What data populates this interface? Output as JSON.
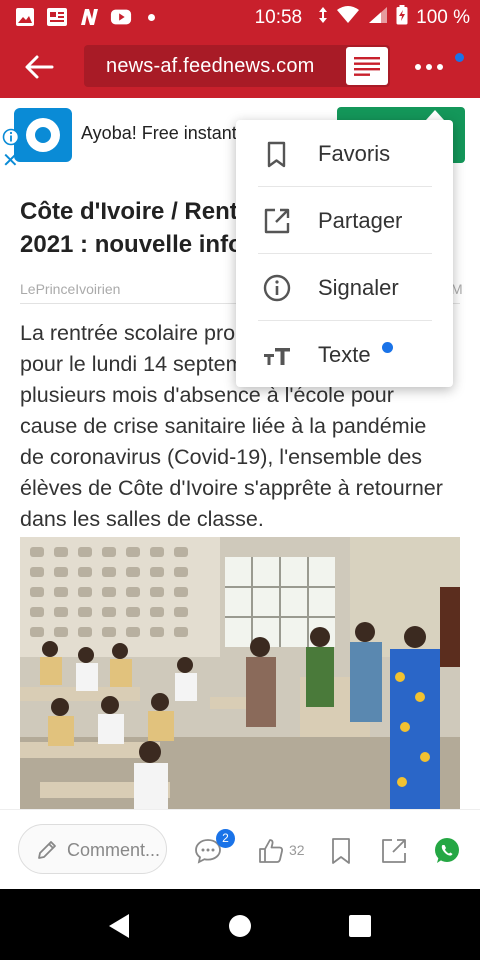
{
  "status_bar": {
    "time": "10:58",
    "battery": "100 %",
    "icons": [
      "gallery-icon",
      "news-icon",
      "n-app-icon",
      "youtube-icon",
      "notification-dot",
      "data-arrows-icon",
      "wifi-icon",
      "signal-icon",
      "battery-icon"
    ]
  },
  "toolbar": {
    "url": "news-af.feednews.com",
    "icons": [
      "back-arrow-icon",
      "reader-mode-icon",
      "more-menu-icon"
    ]
  },
  "ad": {
    "text": "Ayoba! Free instant"
  },
  "article": {
    "title_lines": [
      "Côte d'Ivoire / Rentrée scolaire 2020-",
      "2021 : nouvelle information"
    ],
    "source": "LePrinceIvoirien",
    "source_trailing": "M",
    "body_lines": [
      "La rentrée scolaire prochaine est fixée",
      "pour le lundi 14 septembre 2020. Après",
      "plusieurs mois d'absence à l'école pour",
      "cause de crise sanitaire liée à la pandémie",
      "de coronavirus (Covid-19), l'ensemble des",
      "élèves de Côte d'Ivoire s'apprête à retourner",
      "dans les salles de classe."
    ]
  },
  "action_bar": {
    "comment_placeholder": "Comment...",
    "comment_badge": "2",
    "like_count": "32"
  },
  "menu": {
    "items": [
      {
        "label": "Favoris",
        "icon": "bookmark-icon"
      },
      {
        "label": "Partager",
        "icon": "share-icon"
      },
      {
        "label": "Signaler",
        "icon": "info-icon"
      },
      {
        "label": "Texte",
        "icon": "text-size-icon"
      }
    ]
  },
  "colors": {
    "brand_red": "#c8202c",
    "url_bar": "#a81b26",
    "accent_blue": "#1a73e8",
    "ad_green": "#14975a",
    "whatsapp_green": "#25a744"
  }
}
